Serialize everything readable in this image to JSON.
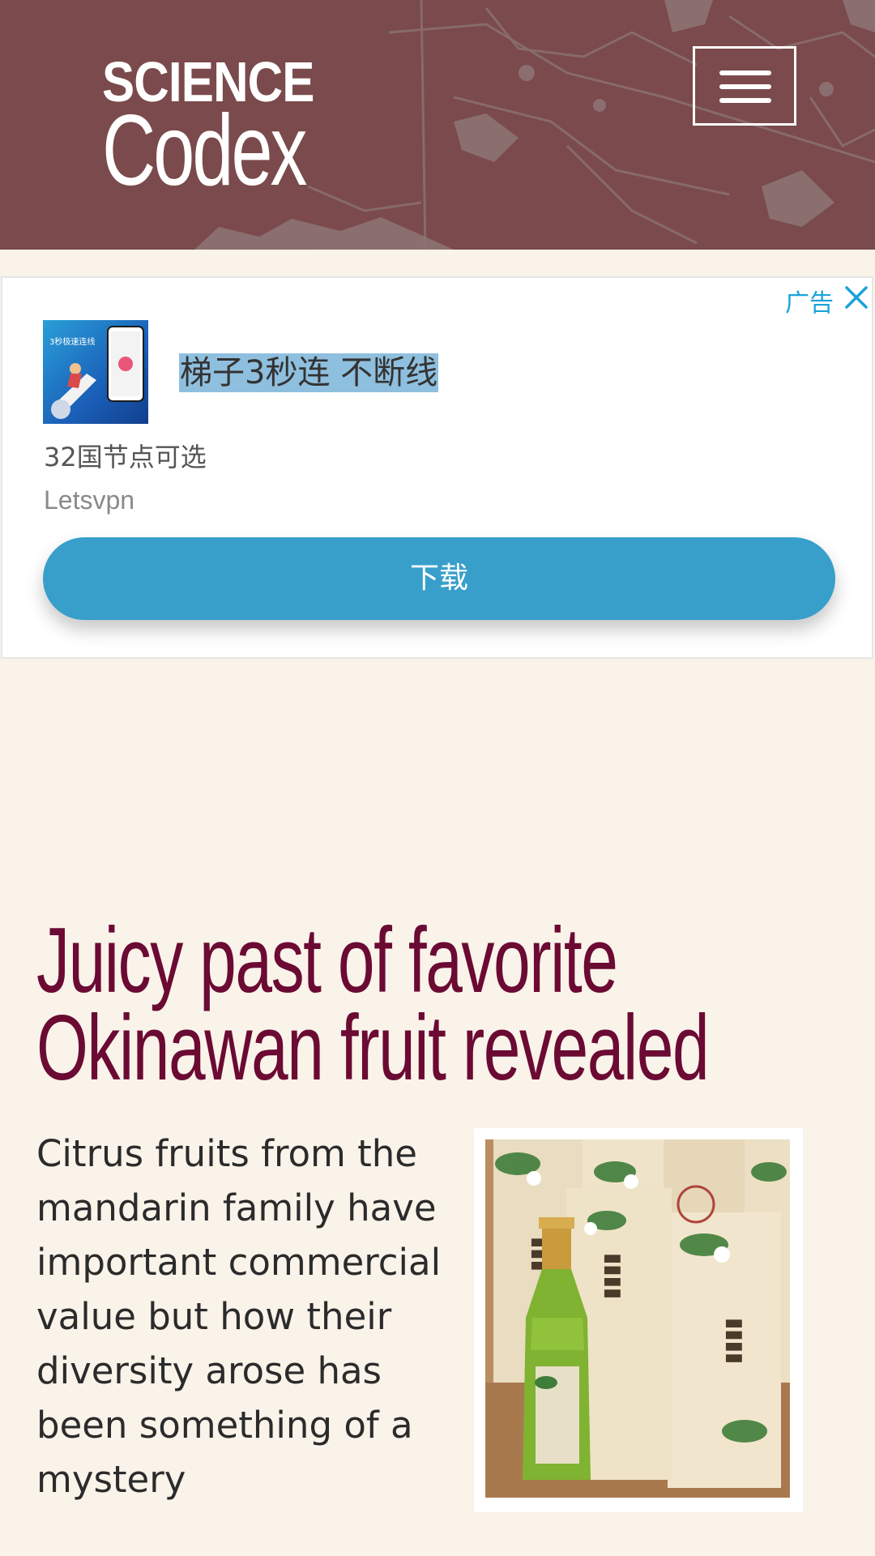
{
  "header": {
    "logo_top": "SCIENCE",
    "logo_bottom": "Codex",
    "background_color": "#7b4a4c",
    "menu_icon": "hamburger-menu-icon"
  },
  "ad": {
    "label": "广告",
    "close_icon": "close-icon",
    "title": "梯子3秒连 不断线",
    "subtitle": "32国节点可选",
    "brand": "Letsvpn",
    "button_label": "下载",
    "button_color": "#389fcb",
    "image_text": "3秒极速连线"
  },
  "article": {
    "headline": [
      "Juicy past of favorite",
      "Okinawan fruit revealed"
    ],
    "summary": "Citrus fruits from the mandarin family have important commercial value but how their diversity arose has been something of a mystery",
    "headline_color": "#6b0a33",
    "image_alt": "Bottle of citrus juice in front of boxes with Japanese labels"
  }
}
